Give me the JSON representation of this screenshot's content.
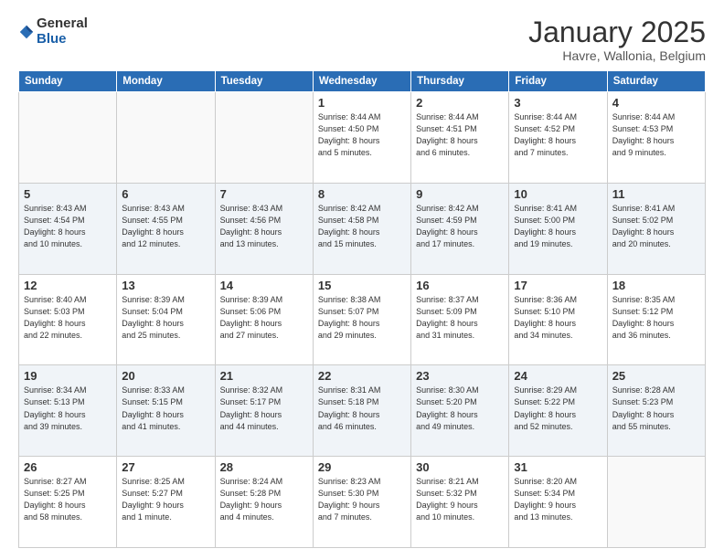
{
  "header": {
    "logo_general": "General",
    "logo_blue": "Blue",
    "title": "January 2025",
    "subtitle": "Havre, Wallonia, Belgium"
  },
  "weekdays": [
    "Sunday",
    "Monday",
    "Tuesday",
    "Wednesday",
    "Thursday",
    "Friday",
    "Saturday"
  ],
  "weeks": [
    [
      {
        "day": "",
        "info": ""
      },
      {
        "day": "",
        "info": ""
      },
      {
        "day": "",
        "info": ""
      },
      {
        "day": "1",
        "info": "Sunrise: 8:44 AM\nSunset: 4:50 PM\nDaylight: 8 hours\nand 5 minutes."
      },
      {
        "day": "2",
        "info": "Sunrise: 8:44 AM\nSunset: 4:51 PM\nDaylight: 8 hours\nand 6 minutes."
      },
      {
        "day": "3",
        "info": "Sunrise: 8:44 AM\nSunset: 4:52 PM\nDaylight: 8 hours\nand 7 minutes."
      },
      {
        "day": "4",
        "info": "Sunrise: 8:44 AM\nSunset: 4:53 PM\nDaylight: 8 hours\nand 9 minutes."
      }
    ],
    [
      {
        "day": "5",
        "info": "Sunrise: 8:43 AM\nSunset: 4:54 PM\nDaylight: 8 hours\nand 10 minutes."
      },
      {
        "day": "6",
        "info": "Sunrise: 8:43 AM\nSunset: 4:55 PM\nDaylight: 8 hours\nand 12 minutes."
      },
      {
        "day": "7",
        "info": "Sunrise: 8:43 AM\nSunset: 4:56 PM\nDaylight: 8 hours\nand 13 minutes."
      },
      {
        "day": "8",
        "info": "Sunrise: 8:42 AM\nSunset: 4:58 PM\nDaylight: 8 hours\nand 15 minutes."
      },
      {
        "day": "9",
        "info": "Sunrise: 8:42 AM\nSunset: 4:59 PM\nDaylight: 8 hours\nand 17 minutes."
      },
      {
        "day": "10",
        "info": "Sunrise: 8:41 AM\nSunset: 5:00 PM\nDaylight: 8 hours\nand 19 minutes."
      },
      {
        "day": "11",
        "info": "Sunrise: 8:41 AM\nSunset: 5:02 PM\nDaylight: 8 hours\nand 20 minutes."
      }
    ],
    [
      {
        "day": "12",
        "info": "Sunrise: 8:40 AM\nSunset: 5:03 PM\nDaylight: 8 hours\nand 22 minutes."
      },
      {
        "day": "13",
        "info": "Sunrise: 8:39 AM\nSunset: 5:04 PM\nDaylight: 8 hours\nand 25 minutes."
      },
      {
        "day": "14",
        "info": "Sunrise: 8:39 AM\nSunset: 5:06 PM\nDaylight: 8 hours\nand 27 minutes."
      },
      {
        "day": "15",
        "info": "Sunrise: 8:38 AM\nSunset: 5:07 PM\nDaylight: 8 hours\nand 29 minutes."
      },
      {
        "day": "16",
        "info": "Sunrise: 8:37 AM\nSunset: 5:09 PM\nDaylight: 8 hours\nand 31 minutes."
      },
      {
        "day": "17",
        "info": "Sunrise: 8:36 AM\nSunset: 5:10 PM\nDaylight: 8 hours\nand 34 minutes."
      },
      {
        "day": "18",
        "info": "Sunrise: 8:35 AM\nSunset: 5:12 PM\nDaylight: 8 hours\nand 36 minutes."
      }
    ],
    [
      {
        "day": "19",
        "info": "Sunrise: 8:34 AM\nSunset: 5:13 PM\nDaylight: 8 hours\nand 39 minutes."
      },
      {
        "day": "20",
        "info": "Sunrise: 8:33 AM\nSunset: 5:15 PM\nDaylight: 8 hours\nand 41 minutes."
      },
      {
        "day": "21",
        "info": "Sunrise: 8:32 AM\nSunset: 5:17 PM\nDaylight: 8 hours\nand 44 minutes."
      },
      {
        "day": "22",
        "info": "Sunrise: 8:31 AM\nSunset: 5:18 PM\nDaylight: 8 hours\nand 46 minutes."
      },
      {
        "day": "23",
        "info": "Sunrise: 8:30 AM\nSunset: 5:20 PM\nDaylight: 8 hours\nand 49 minutes."
      },
      {
        "day": "24",
        "info": "Sunrise: 8:29 AM\nSunset: 5:22 PM\nDaylight: 8 hours\nand 52 minutes."
      },
      {
        "day": "25",
        "info": "Sunrise: 8:28 AM\nSunset: 5:23 PM\nDaylight: 8 hours\nand 55 minutes."
      }
    ],
    [
      {
        "day": "26",
        "info": "Sunrise: 8:27 AM\nSunset: 5:25 PM\nDaylight: 8 hours\nand 58 minutes."
      },
      {
        "day": "27",
        "info": "Sunrise: 8:25 AM\nSunset: 5:27 PM\nDaylight: 9 hours\nand 1 minute."
      },
      {
        "day": "28",
        "info": "Sunrise: 8:24 AM\nSunset: 5:28 PM\nDaylight: 9 hours\nand 4 minutes."
      },
      {
        "day": "29",
        "info": "Sunrise: 8:23 AM\nSunset: 5:30 PM\nDaylight: 9 hours\nand 7 minutes."
      },
      {
        "day": "30",
        "info": "Sunrise: 8:21 AM\nSunset: 5:32 PM\nDaylight: 9 hours\nand 10 minutes."
      },
      {
        "day": "31",
        "info": "Sunrise: 8:20 AM\nSunset: 5:34 PM\nDaylight: 9 hours\nand 13 minutes."
      },
      {
        "day": "",
        "info": ""
      }
    ]
  ]
}
